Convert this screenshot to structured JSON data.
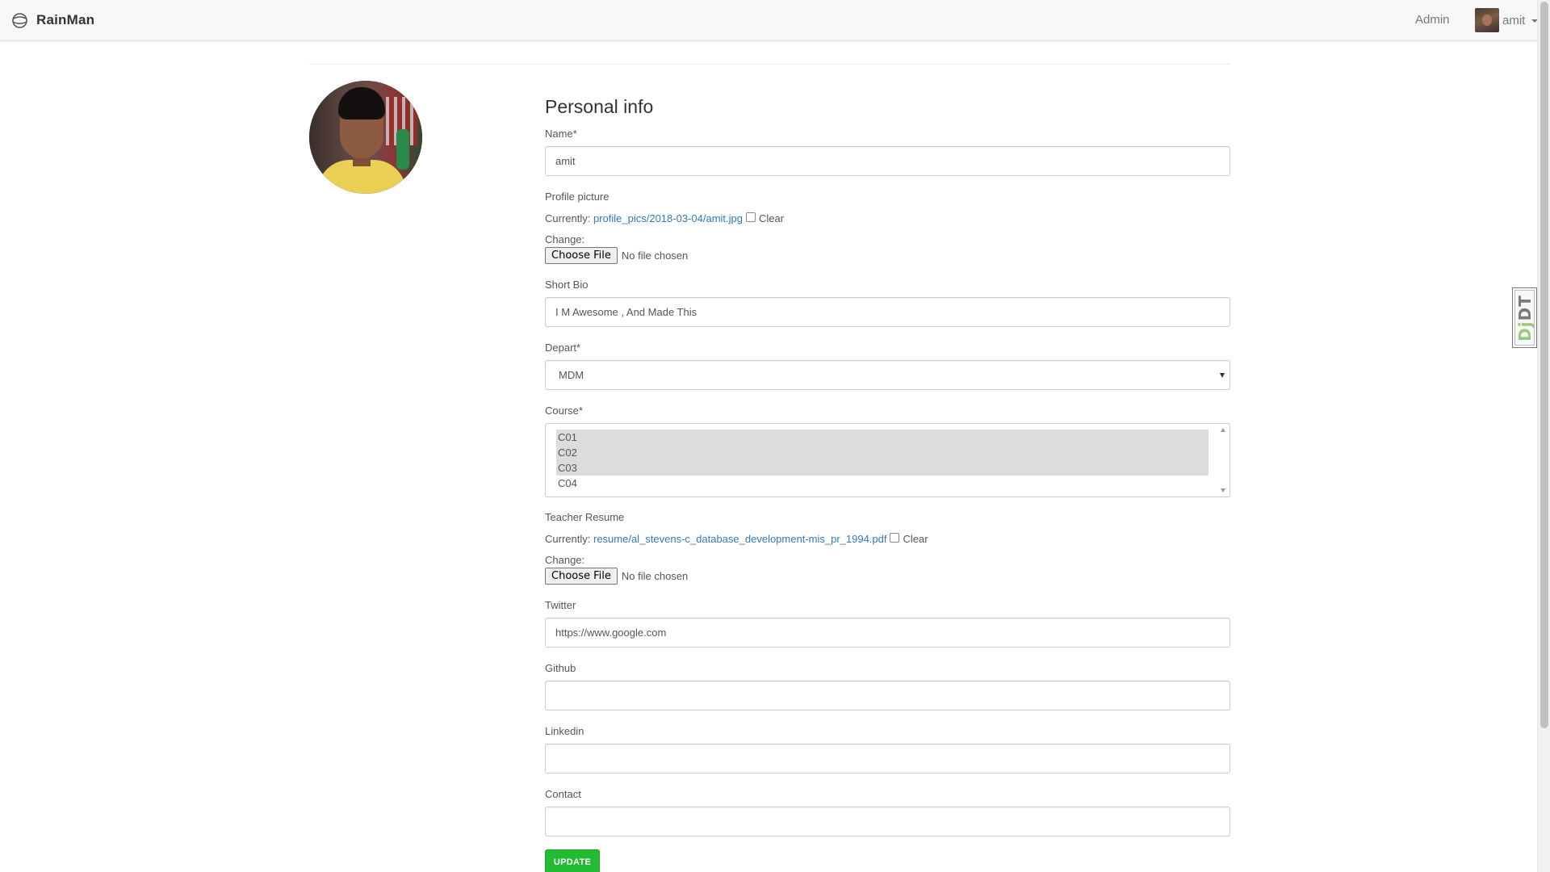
{
  "navbar": {
    "brand": "RainMan",
    "brand_icon": "globe-icon",
    "admin_link": "Admin",
    "username": "amit"
  },
  "sidebar": {
    "avatar": "profile-photo"
  },
  "form": {
    "title": "Personal info",
    "name": {
      "label": "Name*",
      "value": "amit"
    },
    "profile_picture": {
      "label": "Profile picture",
      "currently_label": "Currently:",
      "current_file": "profile_pics/2018-03-04/amit.jpg",
      "clear_label": "Clear",
      "change_label": "Change:",
      "button": "Choose File",
      "status": "No file chosen"
    },
    "short_bio": {
      "label": "Short Bio",
      "value": "I M Awesome , And Made This"
    },
    "depart": {
      "label": "Depart*",
      "value": "MDM"
    },
    "course": {
      "label": "Course*",
      "options": [
        {
          "label": "C01",
          "selected": true
        },
        {
          "label": "C02",
          "selected": true
        },
        {
          "label": "C03",
          "selected": true
        },
        {
          "label": "C04",
          "selected": false
        }
      ]
    },
    "resume": {
      "label": "Teacher Resume",
      "currently_label": "Currently:",
      "current_file": "resume/al_stevens-c_database_development-mis_pr_1994.pdf",
      "clear_label": "Clear",
      "change_label": "Change:",
      "button": "Choose File",
      "status": "No file chosen"
    },
    "twitter": {
      "label": "Twitter",
      "value": "https://www.google.com"
    },
    "github": {
      "label": "Github",
      "value": ""
    },
    "linkedin": {
      "label": "Linkedin",
      "value": ""
    },
    "contact": {
      "label": "Contact",
      "value": ""
    },
    "submit_label": "UPDATE"
  },
  "debug_toolbar": {
    "label_dj": "Dj",
    "label_dt": "DT"
  },
  "colors": {
    "link": "#337ab7",
    "update_button": "#22bb33",
    "navbar_bg": "#f8f8f8"
  }
}
